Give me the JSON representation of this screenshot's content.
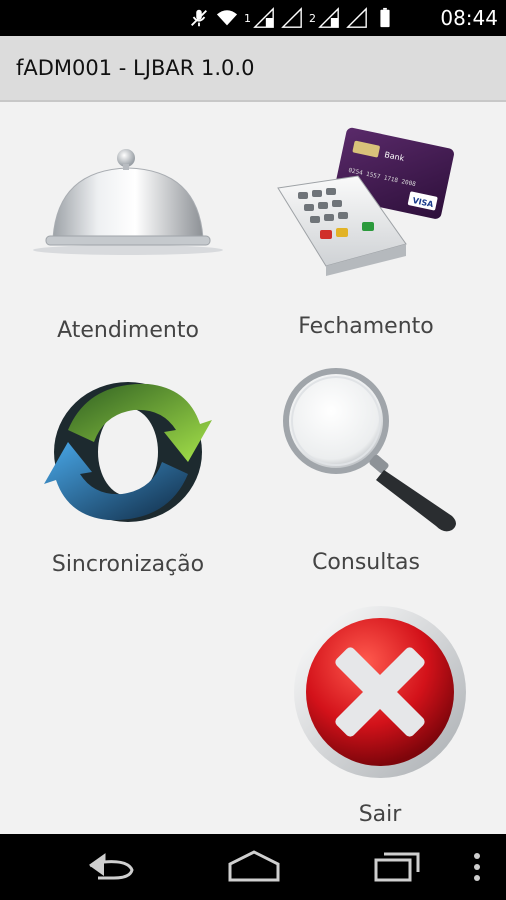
{
  "status_bar": {
    "time": "08:44",
    "sim1_label": "1",
    "sim2_label": "2",
    "icons": [
      "muted-mic-icon",
      "wifi-icon",
      "signal-sim1-icon",
      "signal-sim2-icon",
      "battery-icon"
    ]
  },
  "app_bar": {
    "title": "fADM001 - LJBAR 1.0.0"
  },
  "menu": {
    "items": [
      {
        "label": "Atendimento",
        "icon": "cloche-icon"
      },
      {
        "label": "Fechamento",
        "icon": "card-terminal-icon"
      },
      {
        "label": "Sincronização",
        "icon": "sync-arrows-icon"
      },
      {
        "label": "Consultas",
        "icon": "magnifier-icon"
      },
      {
        "label": "Sair",
        "icon": "exit-x-icon"
      }
    ]
  },
  "card_text": {
    "bank": "Bank",
    "brand": "VISA"
  },
  "nav_bar": {
    "icons": [
      "back-icon",
      "home-icon",
      "recents-icon",
      "overflow-menu-icon"
    ]
  }
}
